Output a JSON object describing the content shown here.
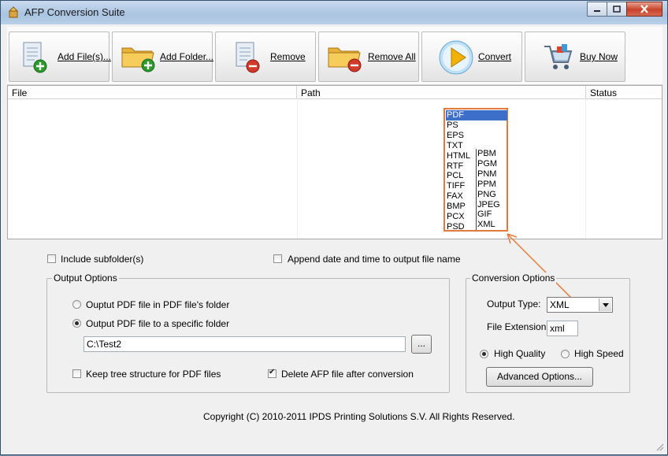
{
  "window": {
    "title": "AFP Conversion Suite"
  },
  "toolbar": {
    "add_files": "Add File(s)...",
    "add_folder": "Add Folder...",
    "remove": "Remove",
    "remove_all": "Remove All",
    "convert": "Convert",
    "buy_now": "Buy Now"
  },
  "filelist": {
    "columns": [
      "File",
      "Path",
      "Status"
    ]
  },
  "format_list": {
    "col1": [
      "PDF",
      "PS",
      "EPS",
      "TXT",
      "HTML",
      "RTF",
      "PCL",
      "TIFF",
      "FAX",
      "BMP",
      "PCX",
      "PSD"
    ],
    "col2": [
      "PBM",
      "PGM",
      "PNM",
      "PPM",
      "PNG",
      "JPEG",
      "GIF",
      "XML"
    ],
    "selected": "PDF"
  },
  "options": {
    "include_subfolders": "Include subfolder(s)",
    "append_datetime": "Append date and time to output file name"
  },
  "output_options": {
    "legend": "Output Options",
    "radio_same_folder": "Ouptut PDF file in PDF file's folder",
    "radio_specific_folder": "Output PDF file to a specific folder",
    "folder_path": "C:\\Test2",
    "browse": "...",
    "keep_tree": "Keep tree structure for PDF files",
    "delete_afp": "Delete AFP file after conversion"
  },
  "conversion_options": {
    "legend": "Conversion Options",
    "output_type_label": "Output Type:",
    "output_type_value": "XML",
    "file_ext_label": "File Extension:",
    "file_ext_value": "xml",
    "high_quality": "High Quality",
    "high_speed": "High Speed",
    "advanced": "Advanced Options..."
  },
  "footer": {
    "copyright": "Copyright (C) 2010-2011 IPDS Printing Solutions S.V.  All Rights Reserved."
  },
  "colors": {
    "accent_orange": "#e07d3e",
    "selection_blue": "#3d6fc9"
  }
}
